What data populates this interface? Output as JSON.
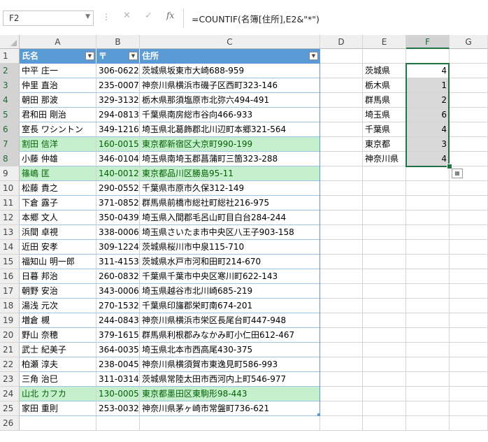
{
  "formula_bar": {
    "name_box": "F2",
    "formula": "=COUNTIF(名簿[住所],E2&\"*\")"
  },
  "columns": [
    "A",
    "B",
    "C",
    "D",
    "E",
    "F",
    "G"
  ],
  "rows": [
    "1",
    "2",
    "3",
    "4",
    "5",
    "6",
    "7",
    "8",
    "9",
    "10",
    "11",
    "12",
    "13",
    "14",
    "15",
    "16",
    "17",
    "18",
    "19",
    "20",
    "21",
    "22",
    "23",
    "24",
    "25",
    "26"
  ],
  "table": {
    "headers": [
      "氏名",
      "〒",
      "住所"
    ],
    "records": [
      [
        "中平 庄一",
        "306-0622",
        "茨城県坂東市大崎688-959"
      ],
      [
        "仲里 直治",
        "235-0007",
        "神奈川県横浜市磯子区西町323-146"
      ],
      [
        "朝田 那波",
        "329-3132",
        "栃木県那須塩原市北弥六494-491"
      ],
      [
        "君和田 剛治",
        "294-0813",
        "千葉県南房総市谷向466-933"
      ],
      [
        "室長 ワシントン",
        "349-1216",
        "埼玉県北葛飾郡北川辺町本郷321-564"
      ],
      [
        "割田 信洋",
        "160-0015",
        "東京都新宿区大京町990-199"
      ],
      [
        "小藤 仲雄",
        "346-0104",
        "埼玉県南埼玉郡菖蒲町三箇323-288"
      ],
      [
        "篠嶋 匡",
        "140-0012",
        "東京都品川区勝島95-11"
      ],
      [
        "松藤 貴之",
        "290-0552",
        "千葉県市原市久保312-149"
      ],
      [
        "下倉 露子",
        "371-0852",
        "群馬県前橋市総社町総社216-975"
      ],
      [
        "本郷 文人",
        "350-0439",
        "埼玉県入間郡毛呂山町目白台284-244"
      ],
      [
        "浜間 卓視",
        "338-0006",
        "埼玉県さいたま市中央区八王子903-158"
      ],
      [
        "近田 安孝",
        "309-1224",
        "茨城県桜川市中泉115-710"
      ],
      [
        "福知山 明一郎",
        "311-4153",
        "茨城県水戸市河和田町214-670"
      ],
      [
        "日暮 邦治",
        "260-0832",
        "千葉県千葉市中央区寒川町622-143"
      ],
      [
        "朝野 安治",
        "343-0006",
        "埼玉県越谷市北川崎685-219"
      ],
      [
        "湯浅 元次",
        "270-1532",
        "千葉県印旛郡栄町南674-201"
      ],
      [
        "増倉 槻",
        "244-0843",
        "神奈川県横浜市栄区長尾台町447-948"
      ],
      [
        "野山 奈穂",
        "379-1615",
        "群馬県利根郡みなかみ町小仁田612-467"
      ],
      [
        "武士 紀美子",
        "364-0035",
        "埼玉県北本市西高尾430-375"
      ],
      [
        "柏瀬 淳夫",
        "238-0045",
        "神奈川県横須賀市東逸見町586-993"
      ],
      [
        "三角 治巳",
        "311-0314",
        "茨城県常陸太田市西河内上町546-977"
      ],
      [
        "山北 カフカ",
        "130-0005",
        "東京都墨田区東駒形98-443"
      ],
      [
        "家田 重則",
        "253-0032",
        "神奈川県茅ヶ崎市常盤町736-621"
      ]
    ],
    "highlighted_record_indexes": [
      5,
      7,
      22
    ]
  },
  "summary": {
    "prefectures": [
      "茨城県",
      "栃木県",
      "群馬県",
      "埼玉県",
      "千葉県",
      "東京都",
      "神奈川県"
    ],
    "counts": [
      "4",
      "1",
      "2",
      "6",
      "4",
      "3",
      "4"
    ]
  },
  "colors": {
    "table_header": "#5b9bd5",
    "highlight_fill": "#c6efce",
    "highlight_text": "#006100",
    "selection_border": "#217346"
  },
  "icons": {
    "quick_analysis": "quick-analysis-icon",
    "filter_dropdown": "filter-dropdown-icon",
    "name_box_dropdown": "chevron-down-icon"
  }
}
